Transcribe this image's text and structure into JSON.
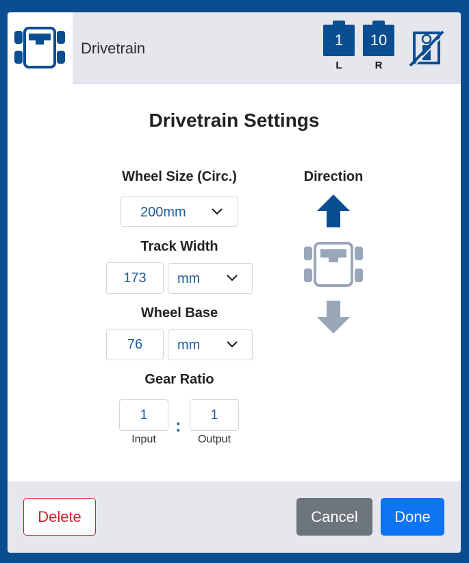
{
  "header": {
    "title": "Drivetrain",
    "ports": [
      {
        "number": "1",
        "label": "L"
      },
      {
        "number": "10",
        "label": "R"
      }
    ],
    "icons": [
      "drivetrain-icon",
      "gyro-disabled-icon"
    ]
  },
  "settings": {
    "title": "Drivetrain Settings",
    "wheel_size": {
      "label": "Wheel Size (Circ.)",
      "value": "200mm"
    },
    "track_width": {
      "label": "Track Width",
      "value": "173",
      "unit": "mm"
    },
    "wheel_base": {
      "label": "Wheel Base",
      "value": "76",
      "unit": "mm"
    },
    "gear_ratio": {
      "label": "Gear Ratio",
      "input_value": "1",
      "input_label": "Input",
      "separator": ":",
      "output_value": "1",
      "output_label": "Output"
    },
    "direction": {
      "label": "Direction",
      "selected": "forward"
    }
  },
  "footer": {
    "delete_label": "Delete",
    "cancel_label": "Cancel",
    "done_label": "Done"
  },
  "colors": {
    "brand_blue": "#0a4d91",
    "accent_blue": "#0d74f4",
    "danger": "#d0202a",
    "muted": "#6c747c",
    "inactive_arrow": "#98a6b8"
  }
}
